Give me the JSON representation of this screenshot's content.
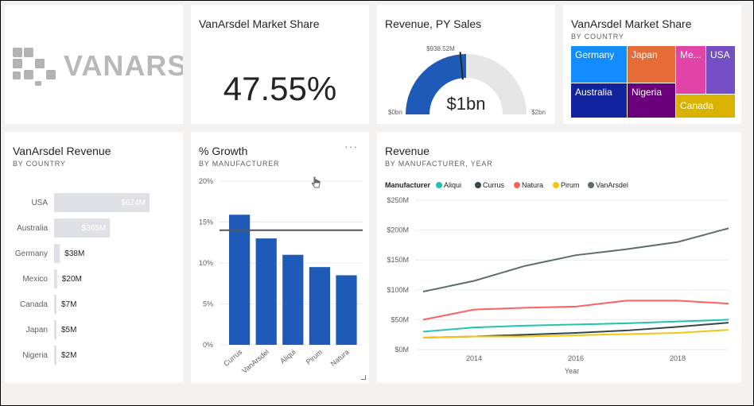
{
  "logo": {
    "text": "VANARSDEL"
  },
  "market_share_card": {
    "title": "VanArsdel Market Share",
    "value": "47.55%"
  },
  "gauge": {
    "title": "Revenue, PY Sales",
    "center_label": "$1bn",
    "min_label": "$0bn",
    "max_label": "$2bn",
    "target_label": "$938.52M",
    "fill_fraction": 0.5,
    "target_fraction": 0.47,
    "fill_color": "#1e5bb8",
    "track_color": "#e6e6e6"
  },
  "treemap": {
    "title": "VanArsdel Market Share",
    "subtitle": "BY COUNTRY",
    "cells": [
      {
        "label": "Germany",
        "color": "#118dff"
      },
      {
        "label": "Japan",
        "color": "#e66c37"
      },
      {
        "label": "Me...",
        "color": "#e044a7"
      },
      {
        "label": "USA",
        "color": "#744ec2"
      },
      {
        "label": "Australia",
        "color": "#12239e"
      },
      {
        "label": "Nigeria",
        "color": "#6b007b"
      },
      {
        "label": "Canada",
        "color": "#d9b300"
      }
    ]
  },
  "country_revenue": {
    "title": "VanArsdel Revenue",
    "subtitle": "BY COUNTRY",
    "rows": [
      {
        "country": "USA",
        "label": "$624M",
        "value": 624
      },
      {
        "country": "Australia",
        "label": "$365M",
        "value": 365
      },
      {
        "country": "Germany",
        "label": "$38M",
        "value": 38
      },
      {
        "country": "Mexico",
        "label": "$20M",
        "value": 20
      },
      {
        "country": "Canada",
        "label": "$7M",
        "value": 7
      },
      {
        "country": "Japan",
        "label": "$5M",
        "value": 5
      },
      {
        "country": "Nigeria",
        "label": "$2M",
        "value": 2
      }
    ]
  },
  "growth": {
    "title": "% Growth",
    "subtitle": "BY MANUFACTURER",
    "more_icon": "more-options-icon"
  },
  "revenue": {
    "title": "Revenue",
    "subtitle": "BY MANUFACTURER, YEAR",
    "legend_title": "Manufacturer"
  },
  "chart_data": [
    {
      "type": "bar",
      "categories": [
        "Currus",
        "VanArsdel",
        "Aliqui",
        "Pirum",
        "Natura"
      ],
      "values": [
        15.9,
        13.0,
        11.0,
        9.5,
        8.5
      ],
      "reference_line": 14.0,
      "ylim": [
        0,
        20
      ],
      "y_ticks": [
        "0%",
        "5%",
        "10%",
        "15%",
        "20%"
      ],
      "color": "#1e5bb8"
    },
    {
      "type": "line",
      "x": [
        2013,
        2014,
        2015,
        2016,
        2017,
        2018,
        2019
      ],
      "x_ticks": [
        "2014",
        "2016",
        "2018"
      ],
      "xlabel": "Year",
      "ylim": [
        0,
        250
      ],
      "y_ticks": [
        "$0M",
        "$50M",
        "$100M",
        "$150M",
        "$200M",
        "$250M"
      ],
      "series": [
        {
          "name": "Aliqui",
          "color": "#20c4b0",
          "values": [
            30,
            37,
            40,
            42,
            44,
            47,
            50
          ]
        },
        {
          "name": "Currus",
          "color": "#374649",
          "values": [
            20,
            22,
            25,
            28,
            32,
            38,
            45
          ]
        },
        {
          "name": "Natura",
          "color": "#fd625e",
          "values": [
            50,
            67,
            70,
            72,
            82,
            82,
            77
          ]
        },
        {
          "name": "Pirum",
          "color": "#f2c80f",
          "values": [
            20,
            22,
            22,
            24,
            26,
            28,
            33
          ]
        },
        {
          "name": "VanArsdel",
          "color": "#5f6b6d",
          "values": [
            97,
            115,
            140,
            158,
            168,
            180,
            203
          ]
        }
      ]
    }
  ]
}
